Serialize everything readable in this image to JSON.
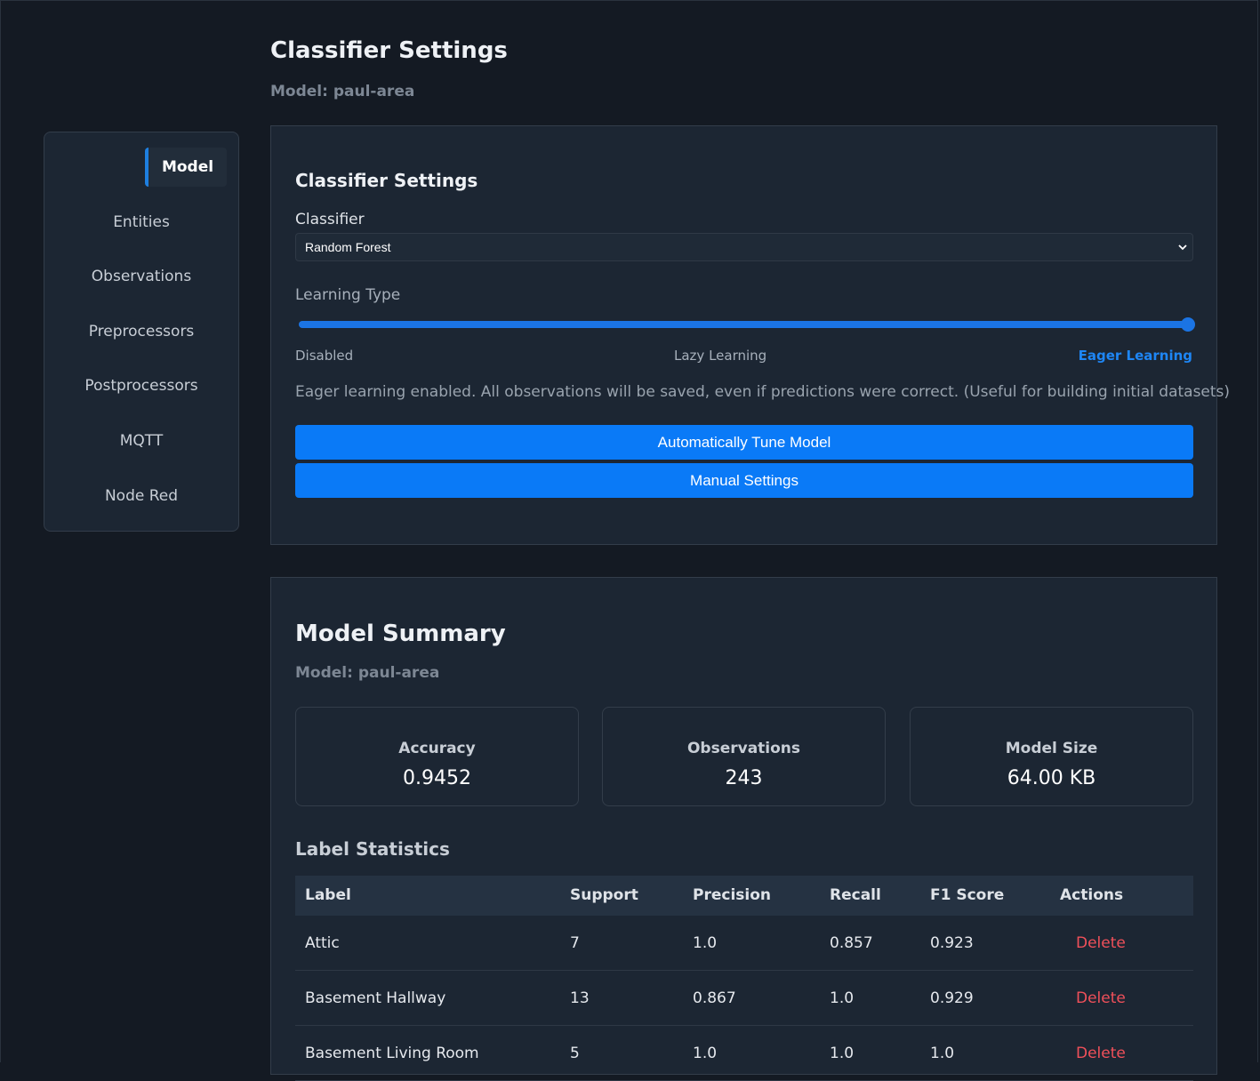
{
  "header": {
    "title": "Classifier Settings",
    "subtitle": "Model: paul-area"
  },
  "sidebar": {
    "items": [
      {
        "label": "Model",
        "active": true
      },
      {
        "label": "Entities"
      },
      {
        "label": "Observations"
      },
      {
        "label": "Preprocessors"
      },
      {
        "label": "Postprocessors"
      },
      {
        "label": "MQTT"
      },
      {
        "label": "Node Red"
      }
    ]
  },
  "classifier_card": {
    "title": "Classifier Settings",
    "classifier_label": "Classifier",
    "classifier_value": "Random Forest",
    "learning_type_label": "Learning Type",
    "learning_levels": [
      "Disabled",
      "Lazy Learning",
      "Eager Learning"
    ],
    "learning_selected": "Eager Learning",
    "description": "Eager learning enabled. All observations will be saved, even if predictions were correct. (Useful for building initial datasets)",
    "auto_tune_button": "Automatically Tune Model",
    "manual_button": "Manual Settings"
  },
  "summary_card": {
    "title": "Model Summary",
    "subtitle": "Model: paul-area",
    "stats": [
      {
        "label": "Accuracy",
        "value": "0.9452"
      },
      {
        "label": "Observations",
        "value": "243"
      },
      {
        "label": "Model Size",
        "value": "64.00 KB"
      }
    ],
    "label_stats_title": "Label Statistics",
    "columns": [
      "Label",
      "Support",
      "Precision",
      "Recall",
      "F1 Score",
      "Actions"
    ],
    "rows": [
      {
        "label": "Attic",
        "support": "7",
        "precision": "1.0",
        "recall": "0.857",
        "f1": "0.923",
        "action": "Delete"
      },
      {
        "label": "Basement Hallway",
        "support": "13",
        "precision": "0.867",
        "recall": "1.0",
        "f1": "0.929",
        "action": "Delete"
      },
      {
        "label": "Basement Living Room",
        "support": "5",
        "precision": "1.0",
        "recall": "1.0",
        "f1": "1.0",
        "action": "Delete"
      }
    ]
  },
  "colors": {
    "background": "#141a23",
    "card": "#1c2633",
    "accent": "#0a7af7",
    "danger": "#f0505a"
  }
}
